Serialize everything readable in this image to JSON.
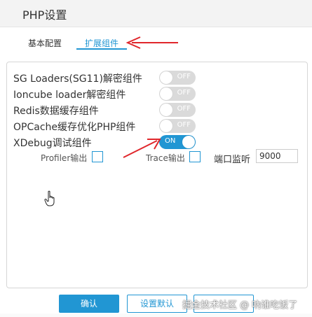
{
  "window": {
    "title": "PHP设置"
  },
  "tabs": [
    {
      "label": "基本配置",
      "active": false
    },
    {
      "label": "扩展组件",
      "active": true
    }
  ],
  "extensions": [
    {
      "label": "SG Loaders(SG11)解密组件",
      "state": "OFF"
    },
    {
      "label": "Ioncube loader解密组件",
      "state": "OFF"
    },
    {
      "label": "Redis数据缓存组件",
      "state": "OFF"
    },
    {
      "label": "OPCache缓存优化PHP组件",
      "state": "OFF"
    },
    {
      "label": "XDebug调试组件",
      "state": "ON"
    }
  ],
  "xdebug_options": {
    "profiler_label": "Profiler输出",
    "trace_label": "Trace输出",
    "port_label": "端口监听",
    "port_value": "9000"
  },
  "buttons": {
    "confirm": "确认",
    "reset": "设置默认",
    "cancel": "取消"
  },
  "watermark": "掘金技术社区 @ 吶谁吃饭了",
  "colors": {
    "accent": "#2196d3",
    "annotation_arrow": "#e0262b",
    "toggle_off": "#dadada"
  }
}
